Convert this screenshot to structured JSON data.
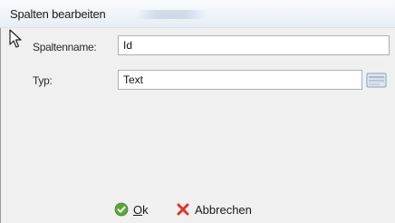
{
  "window": {
    "title": "Spalten bearbeiten"
  },
  "form": {
    "name_label": "Spaltenname:",
    "name_value": "Id",
    "type_label": "Typ:",
    "type_value": "Text"
  },
  "buttons": {
    "ok_mnemonic": "O",
    "ok_rest": "k",
    "cancel_label": "Abbrechen"
  },
  "icons": {
    "ok": "checkmark-icon",
    "cancel": "x-icon",
    "type_picker": "list-picker-icon",
    "cursor": "mouse-pointer-icon"
  },
  "colors": {
    "ok_icon": "#5aa63a",
    "cancel_icon": "#e0342b",
    "dialog_body": "#f0f0f0",
    "title_bar": "#eef3f8"
  }
}
